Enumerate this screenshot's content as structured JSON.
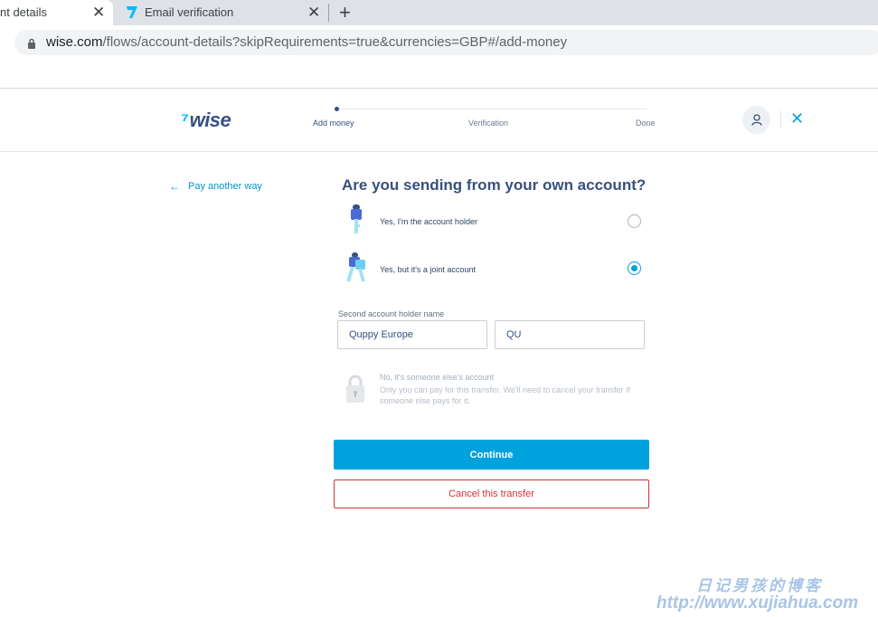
{
  "browser": {
    "tabs": [
      {
        "label": "nt details",
        "close": "✕",
        "active": true
      },
      {
        "label": "Email verification",
        "close": "✕",
        "active": false,
        "favicon": "wise-flag-icon"
      }
    ],
    "new_tab": "+",
    "url_host": "wise.com",
    "url_rest": "/flows/account-details?skipRequirements=true&currencies=GBP#/add-money"
  },
  "header": {
    "logo": "wise",
    "steps": [
      {
        "label": "Add money",
        "active": true
      },
      {
        "label": "Verification",
        "active": false
      },
      {
        "label": "Done",
        "active": false
      }
    ],
    "close": "✕"
  },
  "main": {
    "pay_another": "Pay another way",
    "question": "Are you sending from your own account?",
    "options": [
      {
        "label": "Yes, I'm the account holder",
        "selected": false
      },
      {
        "label": "Yes, but it's a joint account",
        "selected": true
      }
    ],
    "second_holder": {
      "label": "Second account holder name",
      "first_name": "Quppy Europe",
      "last_name": "QU"
    },
    "disabled_option": {
      "label": "No, it's someone else's account",
      "description": "Only you can pay for this transfer. We'll need to cancel your transfer if someone else pays for it."
    },
    "continue_label": "Continue",
    "cancel_label": "Cancel this transfer"
  },
  "watermark": {
    "line1": "日记男孩的博客",
    "line2": "http://www.xujiahua.com"
  },
  "colors": {
    "accent": "#00a2dd",
    "navy": "#37517e",
    "danger": "#d03238"
  }
}
